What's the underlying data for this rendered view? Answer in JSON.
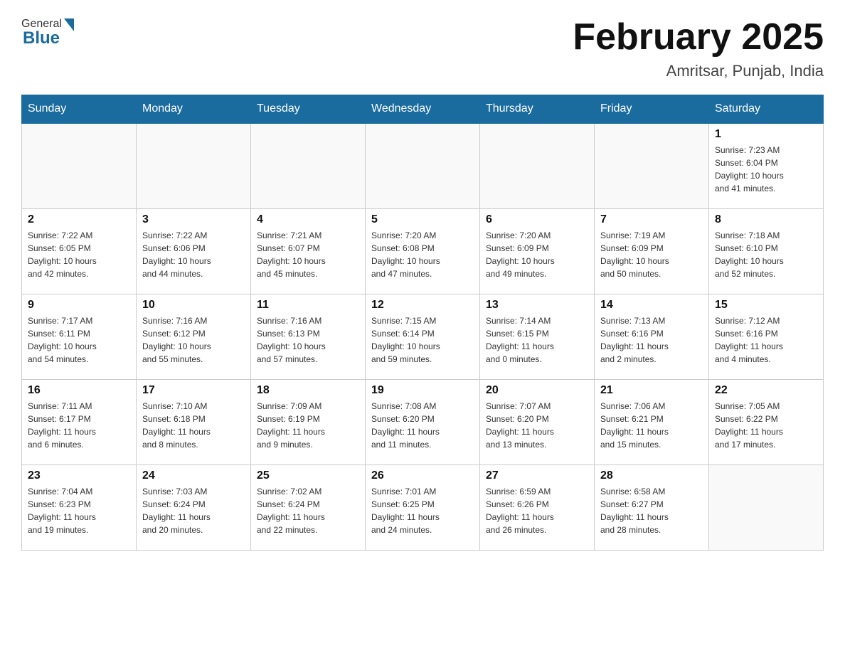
{
  "header": {
    "title": "February 2025",
    "subtitle": "Amritsar, Punjab, India",
    "logo_general": "General",
    "logo_blue": "Blue"
  },
  "days_of_week": [
    "Sunday",
    "Monday",
    "Tuesday",
    "Wednesday",
    "Thursday",
    "Friday",
    "Saturday"
  ],
  "weeks": [
    [
      {
        "day": "",
        "info": ""
      },
      {
        "day": "",
        "info": ""
      },
      {
        "day": "",
        "info": ""
      },
      {
        "day": "",
        "info": ""
      },
      {
        "day": "",
        "info": ""
      },
      {
        "day": "",
        "info": ""
      },
      {
        "day": "1",
        "info": "Sunrise: 7:23 AM\nSunset: 6:04 PM\nDaylight: 10 hours\nand 41 minutes."
      }
    ],
    [
      {
        "day": "2",
        "info": "Sunrise: 7:22 AM\nSunset: 6:05 PM\nDaylight: 10 hours\nand 42 minutes."
      },
      {
        "day": "3",
        "info": "Sunrise: 7:22 AM\nSunset: 6:06 PM\nDaylight: 10 hours\nand 44 minutes."
      },
      {
        "day": "4",
        "info": "Sunrise: 7:21 AM\nSunset: 6:07 PM\nDaylight: 10 hours\nand 45 minutes."
      },
      {
        "day": "5",
        "info": "Sunrise: 7:20 AM\nSunset: 6:08 PM\nDaylight: 10 hours\nand 47 minutes."
      },
      {
        "day": "6",
        "info": "Sunrise: 7:20 AM\nSunset: 6:09 PM\nDaylight: 10 hours\nand 49 minutes."
      },
      {
        "day": "7",
        "info": "Sunrise: 7:19 AM\nSunset: 6:09 PM\nDaylight: 10 hours\nand 50 minutes."
      },
      {
        "day": "8",
        "info": "Sunrise: 7:18 AM\nSunset: 6:10 PM\nDaylight: 10 hours\nand 52 minutes."
      }
    ],
    [
      {
        "day": "9",
        "info": "Sunrise: 7:17 AM\nSunset: 6:11 PM\nDaylight: 10 hours\nand 54 minutes."
      },
      {
        "day": "10",
        "info": "Sunrise: 7:16 AM\nSunset: 6:12 PM\nDaylight: 10 hours\nand 55 minutes."
      },
      {
        "day": "11",
        "info": "Sunrise: 7:16 AM\nSunset: 6:13 PM\nDaylight: 10 hours\nand 57 minutes."
      },
      {
        "day": "12",
        "info": "Sunrise: 7:15 AM\nSunset: 6:14 PM\nDaylight: 10 hours\nand 59 minutes."
      },
      {
        "day": "13",
        "info": "Sunrise: 7:14 AM\nSunset: 6:15 PM\nDaylight: 11 hours\nand 0 minutes."
      },
      {
        "day": "14",
        "info": "Sunrise: 7:13 AM\nSunset: 6:16 PM\nDaylight: 11 hours\nand 2 minutes."
      },
      {
        "day": "15",
        "info": "Sunrise: 7:12 AM\nSunset: 6:16 PM\nDaylight: 11 hours\nand 4 minutes."
      }
    ],
    [
      {
        "day": "16",
        "info": "Sunrise: 7:11 AM\nSunset: 6:17 PM\nDaylight: 11 hours\nand 6 minutes."
      },
      {
        "day": "17",
        "info": "Sunrise: 7:10 AM\nSunset: 6:18 PM\nDaylight: 11 hours\nand 8 minutes."
      },
      {
        "day": "18",
        "info": "Sunrise: 7:09 AM\nSunset: 6:19 PM\nDaylight: 11 hours\nand 9 minutes."
      },
      {
        "day": "19",
        "info": "Sunrise: 7:08 AM\nSunset: 6:20 PM\nDaylight: 11 hours\nand 11 minutes."
      },
      {
        "day": "20",
        "info": "Sunrise: 7:07 AM\nSunset: 6:20 PM\nDaylight: 11 hours\nand 13 minutes."
      },
      {
        "day": "21",
        "info": "Sunrise: 7:06 AM\nSunset: 6:21 PM\nDaylight: 11 hours\nand 15 minutes."
      },
      {
        "day": "22",
        "info": "Sunrise: 7:05 AM\nSunset: 6:22 PM\nDaylight: 11 hours\nand 17 minutes."
      }
    ],
    [
      {
        "day": "23",
        "info": "Sunrise: 7:04 AM\nSunset: 6:23 PM\nDaylight: 11 hours\nand 19 minutes."
      },
      {
        "day": "24",
        "info": "Sunrise: 7:03 AM\nSunset: 6:24 PM\nDaylight: 11 hours\nand 20 minutes."
      },
      {
        "day": "25",
        "info": "Sunrise: 7:02 AM\nSunset: 6:24 PM\nDaylight: 11 hours\nand 22 minutes."
      },
      {
        "day": "26",
        "info": "Sunrise: 7:01 AM\nSunset: 6:25 PM\nDaylight: 11 hours\nand 24 minutes."
      },
      {
        "day": "27",
        "info": "Sunrise: 6:59 AM\nSunset: 6:26 PM\nDaylight: 11 hours\nand 26 minutes."
      },
      {
        "day": "28",
        "info": "Sunrise: 6:58 AM\nSunset: 6:27 PM\nDaylight: 11 hours\nand 28 minutes."
      },
      {
        "day": "",
        "info": ""
      }
    ]
  ]
}
